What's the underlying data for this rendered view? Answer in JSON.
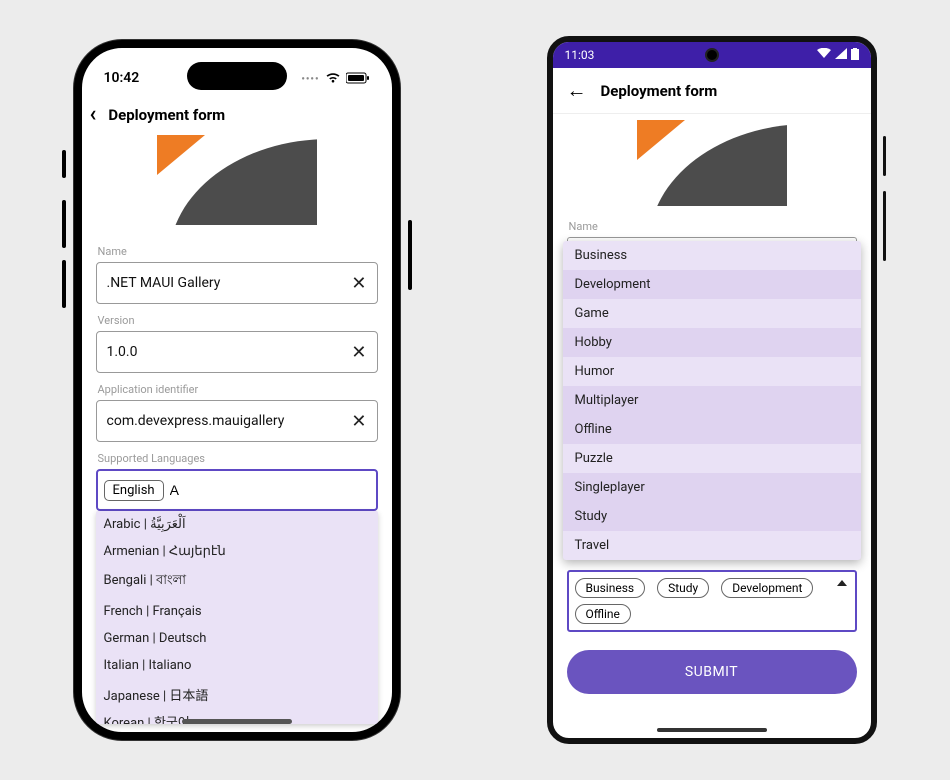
{
  "iphone": {
    "status": {
      "time": "10:42"
    },
    "header": {
      "title": "Deployment form"
    },
    "fields": {
      "name": {
        "label": "Name",
        "value": ".NET MAUI Gallery"
      },
      "version": {
        "label": "Version",
        "value": "1.0.0"
      },
      "appid": {
        "label": "Application identifier",
        "value": "com.devexpress.mauigallery"
      },
      "langs": {
        "label": "Supported Languages",
        "chip": "English",
        "typed": "A"
      }
    },
    "lang_options": [
      "Arabic | اَلْعَرَبِيَّةُ",
      "Armenian | Հայերէն",
      "Bengali | বাংলা",
      "French | Français",
      "German | Deutsch",
      "Italian | Italiano",
      "Japanese | 日本語",
      "Korean | 한국어"
    ]
  },
  "android": {
    "status": {
      "time": "11:03"
    },
    "header": {
      "title": "Deployment form"
    },
    "name_label": "Name",
    "category_options": [
      {
        "label": "Business",
        "dim": false
      },
      {
        "label": "Development",
        "dim": true
      },
      {
        "label": "Game",
        "dim": false
      },
      {
        "label": "Hobby",
        "dim": true
      },
      {
        "label": "Humor",
        "dim": false
      },
      {
        "label": "Multiplayer",
        "dim": true
      },
      {
        "label": "Offline",
        "dim": true
      },
      {
        "label": "Puzzle",
        "dim": false
      },
      {
        "label": "Singleplayer",
        "dim": true
      },
      {
        "label": "Study",
        "dim": true
      },
      {
        "label": "Travel",
        "dim": false
      }
    ],
    "selected_tokens": [
      "Business",
      "Study",
      "Development",
      "Offline"
    ],
    "submit_label": "SUBMIT"
  }
}
